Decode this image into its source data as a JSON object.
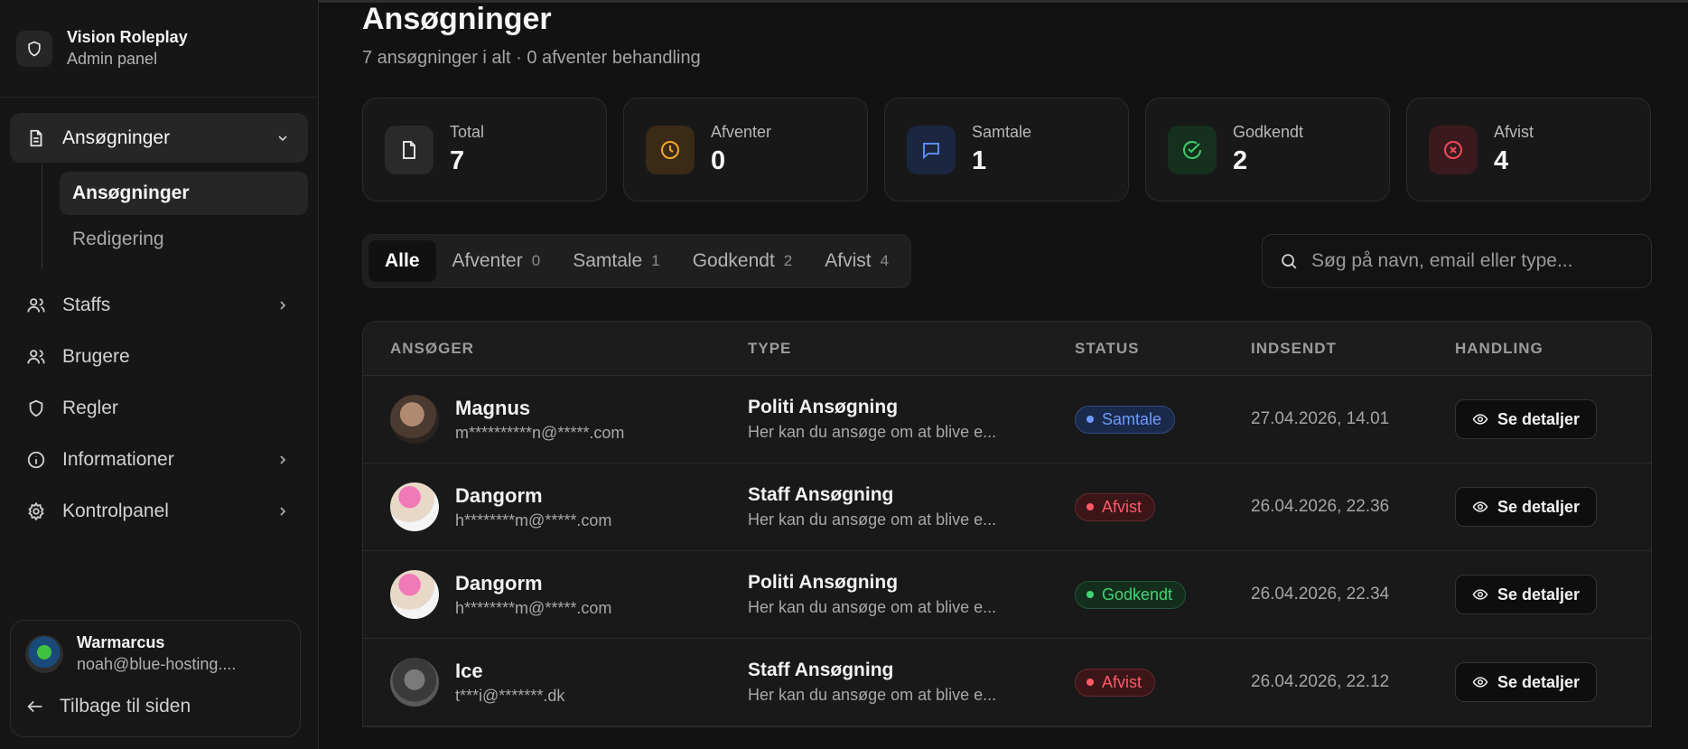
{
  "brand": {
    "name": "Vision Roleplay",
    "subtitle": "Admin panel"
  },
  "sidebar": {
    "items": [
      {
        "label": "Ansøgninger",
        "icon": "document-icon",
        "expanded": true
      },
      {
        "label": "Staffs",
        "icon": "users-icon"
      },
      {
        "label": "Brugere",
        "icon": "users-icon"
      },
      {
        "label": "Regler",
        "icon": "shield-icon"
      },
      {
        "label": "Informationer",
        "icon": "info-icon"
      },
      {
        "label": "Kontrolpanel",
        "icon": "gear-icon"
      }
    ],
    "sub_items": [
      "Ansøgninger",
      "Redigering"
    ]
  },
  "user": {
    "name": "Warmarcus",
    "email": "noah@blue-hosting....",
    "back_label": "Tilbage til siden"
  },
  "page": {
    "title": "Ansøgninger",
    "subtitle": "7 ansøgninger i alt · 0 afventer behandling"
  },
  "stats": [
    {
      "label": "Total",
      "value": "7",
      "color": "#d9d9d9",
      "bg": "#2a2a2a"
    },
    {
      "label": "Afventer",
      "value": "0",
      "color": "#f0a830",
      "bg": "#3a2a16"
    },
    {
      "label": "Samtale",
      "value": "1",
      "color": "#5b8def",
      "bg": "#1b2640"
    },
    {
      "label": "Godkendt",
      "value": "2",
      "color": "#3fcf6a",
      "bg": "#15301f"
    },
    {
      "label": "Afvist",
      "value": "4",
      "color": "#ef4b5a",
      "bg": "#3a1a1e"
    }
  ],
  "tabs": [
    {
      "label": "Alle",
      "count": ""
    },
    {
      "label": "Afventer",
      "count": "0"
    },
    {
      "label": "Samtale",
      "count": "1"
    },
    {
      "label": "Godkendt",
      "count": "2"
    },
    {
      "label": "Afvist",
      "count": "4"
    }
  ],
  "search": {
    "placeholder": "Søg på navn, email eller type..."
  },
  "table": {
    "headers": [
      "ANSØGER",
      "TYPE",
      "STATUS",
      "INDSENDT",
      "HANDLING"
    ],
    "action_label": "Se detaljer",
    "rows": [
      {
        "name": "Magnus",
        "email": "m**********n@*****.com",
        "type": "Politi Ansøgning",
        "desc": "Her kan du ansøge om at blive e...",
        "status": "Samtale",
        "date": "27.04.2026, 14.01"
      },
      {
        "name": "Dangorm",
        "email": "h********m@*****.com",
        "type": "Staff Ansøgning",
        "desc": "Her kan du ansøge om at blive e...",
        "status": "Afvist",
        "date": "26.04.2026, 22.36"
      },
      {
        "name": "Dangorm",
        "email": "h********m@*****.com",
        "type": "Politi Ansøgning",
        "desc": "Her kan du ansøge om at blive e...",
        "status": "Godkendt",
        "date": "26.04.2026, 22.34"
      },
      {
        "name": "Ice",
        "email": "t***i@*******.dk",
        "type": "Staff Ansøgning",
        "desc": "Her kan du ansøge om at blive e...",
        "status": "Afvist",
        "date": "26.04.2026, 22.12"
      }
    ]
  },
  "status_colors": {
    "Samtale": {
      "fg": "#6d9bff",
      "bg": "#1a2a4a",
      "border": "#2e4a80"
    },
    "Afvist": {
      "fg": "#ff5a66",
      "bg": "#3a1619",
      "border": "#6a2830"
    },
    "Godkendt": {
      "fg": "#44d474",
      "bg": "#142e1d",
      "border": "#22553a"
    }
  }
}
